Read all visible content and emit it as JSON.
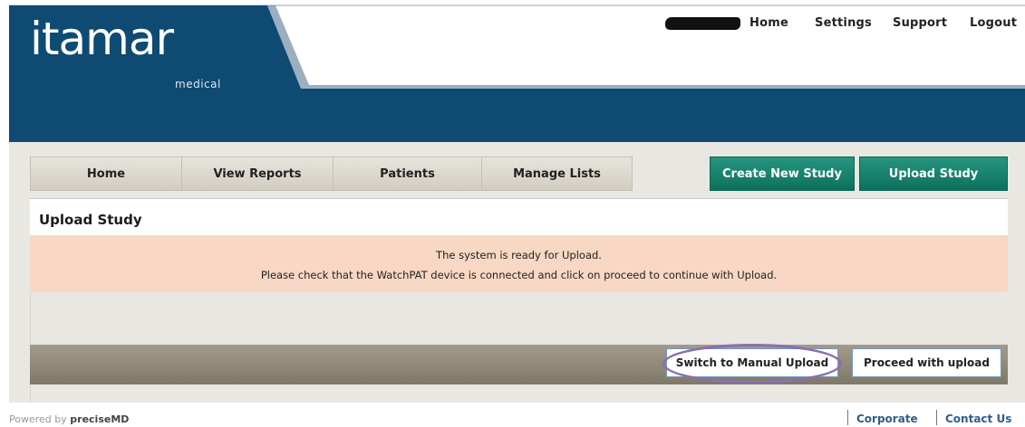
{
  "brand": {
    "logo_text": "itamar",
    "logo_sub": "medical",
    "primary_color": "#0e4a72"
  },
  "header_nav": {
    "username_redacted": true,
    "items": [
      {
        "label": "Home"
      },
      {
        "label": "Settings"
      },
      {
        "label": "Support"
      },
      {
        "label": "Logout"
      }
    ]
  },
  "tabs": [
    {
      "label": "Home"
    },
    {
      "label": "View Reports"
    },
    {
      "label": "Patients"
    },
    {
      "label": "Manage Lists"
    }
  ],
  "action_tabs": [
    {
      "label": "Create New Study",
      "color": "#0f7a63"
    },
    {
      "label": "Upload Study",
      "color": "#0f7a63"
    }
  ],
  "panel": {
    "title": "Upload Study",
    "message_line1": "The system is ready for Upload.",
    "message_line2": "Please check that the WatchPAT device is connected and click on proceed to continue with Upload.",
    "message_bg_color": "#f8d7c4"
  },
  "buttons": {
    "manual_upload": "Switch to Manual Upload",
    "proceed": "Proceed with upload"
  },
  "annotation": {
    "highlighted": "Switch to Manual Upload",
    "color": "#8b6fae"
  },
  "footer": {
    "powered_by_prefix": "Powered by ",
    "powered_by_brand": "preciseMD",
    "links": [
      {
        "label": "Corporate"
      },
      {
        "label": "Contact Us"
      }
    ]
  }
}
